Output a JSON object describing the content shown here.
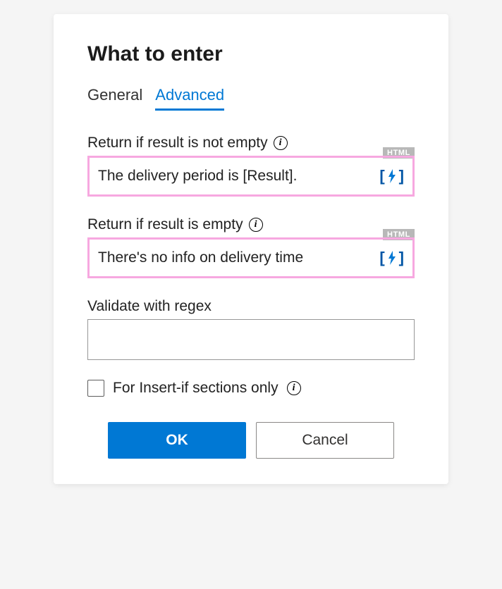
{
  "title": "What to enter",
  "tabs": {
    "general": "General",
    "advanced": "Advanced"
  },
  "fields": {
    "not_empty": {
      "label": "Return if result is not empty",
      "badge": "HTML",
      "value": "The delivery period is [Result]."
    },
    "empty": {
      "label": "Return if result is empty",
      "badge": "HTML",
      "value": "There's no info on delivery time"
    },
    "regex": {
      "label": "Validate with regex",
      "value": ""
    }
  },
  "checkbox": {
    "label": "For Insert-if sections only"
  },
  "buttons": {
    "ok": "OK",
    "cancel": "Cancel"
  }
}
